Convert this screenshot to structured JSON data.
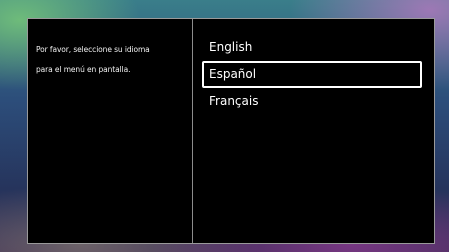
{
  "dialog": {
    "prompt_line1": "Por favor, seleccione su idioma",
    "prompt_line2": "para el menú en pantalla."
  },
  "languages": [
    {
      "label": "English",
      "selected": false
    },
    {
      "label": "Español",
      "selected": true
    },
    {
      "label": "Français",
      "selected": false
    }
  ]
}
